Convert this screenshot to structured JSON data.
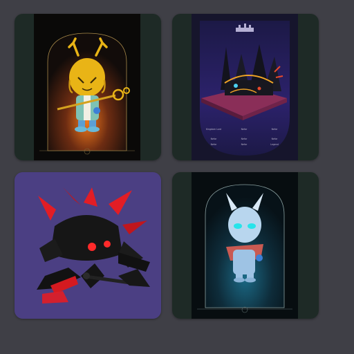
{
  "gallery": {
    "items": [
      {
        "id": 1,
        "icon": "golden-antlered-knight-card-icon",
        "accent": "#e9b416",
        "background": "#1e2a26"
      },
      {
        "id": 2,
        "icon": "dark-castle-card-icon",
        "accent": "#7a6cd8",
        "background": "#1e2a26"
      },
      {
        "id": 3,
        "icon": "black-red-spiked-beast-icon",
        "accent": "#e21d25",
        "background": "#4b3f83"
      },
      {
        "id": 4,
        "icon": "pale-blue-spirit-card-icon",
        "accent": "#9fd2ff",
        "background": "#1e2a26"
      }
    ]
  },
  "card2": {
    "stats": {
      "left": [
        "Kingdom Lord",
        "Nefar",
        "Nefar"
      ],
      "center": [
        "Nefar",
        "Nefar",
        "Nefar"
      ],
      "right": [
        "Nefar",
        "Nefar",
        "Legend"
      ]
    }
  }
}
